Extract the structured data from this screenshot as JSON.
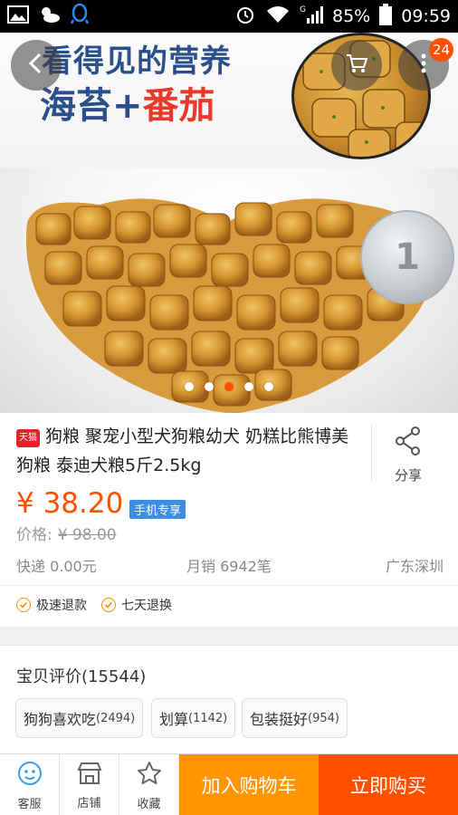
{
  "status_bar": {
    "battery": "85%",
    "time": "09:59",
    "network": "G"
  },
  "hero": {
    "promo_line1": "看得见的营养",
    "promo_line2_a": "海苔",
    "promo_line2_sep": "+",
    "promo_line2_b": "番茄",
    "coin_text": "1",
    "cart_badge": "24",
    "carousel_total": 5,
    "carousel_active": 3
  },
  "product": {
    "store_tag": "天猫",
    "title": "狗粮 聚宠小型犬狗粮幼犬 奶糕比熊博美狗粮  泰迪犬粮5斤2.5kg",
    "share_label": "分享",
    "price": "¥ 38.20",
    "mobile_tag": "手机专享",
    "original_label": "价格:",
    "original_price": "¥ 98.00",
    "shipping": "快递 0.00元",
    "monthly_sales": "月销 6942笔",
    "location": "广东深圳",
    "services": [
      "极速退款",
      "七天退换"
    ]
  },
  "reviews": {
    "title": "宝贝评价(15544)",
    "tags": [
      {
        "label": "狗狗喜欢吃",
        "count": "(2494)"
      },
      {
        "label": "划算",
        "count": "(1142)"
      },
      {
        "label": "包装挺好",
        "count": "(954)"
      }
    ]
  },
  "bottom_bar": {
    "service_label": "客服",
    "store_label": "店铺",
    "favorite_label": "收藏",
    "add_cart_label": "加入购物车",
    "buy_now_label": "立即购买"
  },
  "colors": {
    "accent": "#ff5000",
    "cart_button": "#ff9500",
    "mobile_tag": "#3c8ee0"
  }
}
